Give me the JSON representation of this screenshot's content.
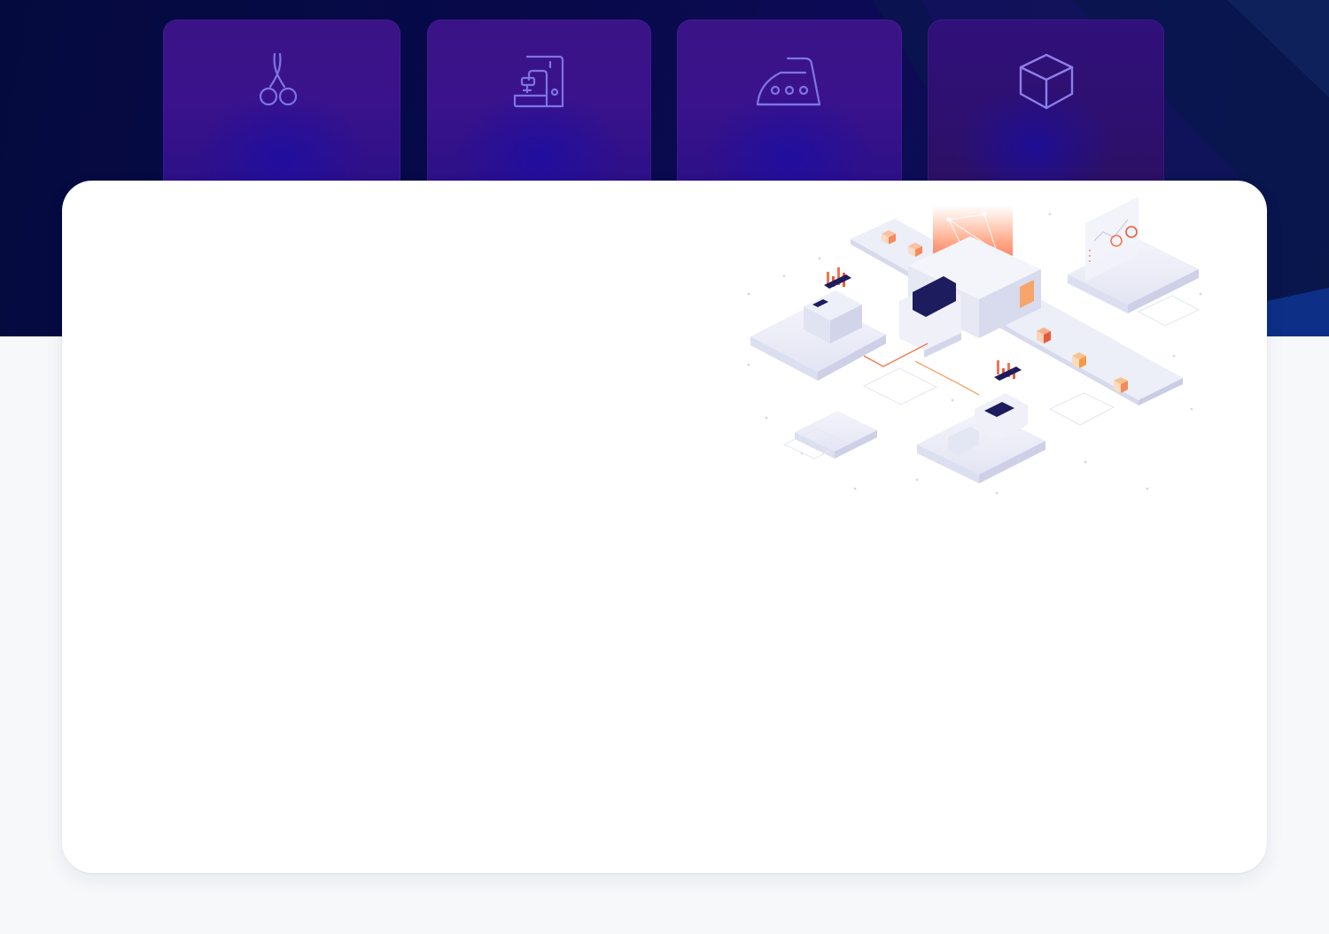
{
  "hero": {
    "feature_cards": [
      {
        "icon": "scissors-icon"
      },
      {
        "icon": "sewing-machine-icon"
      },
      {
        "icon": "clothes-iron-icon"
      },
      {
        "icon": "cube-icon"
      }
    ]
  },
  "panel": {
    "illustration": "isometric-factory-illustration"
  },
  "colors": {
    "hero_background": "#07094a",
    "card_background": "#3a138c",
    "icon_stroke": "#7f74e6",
    "panel_background": "#ffffff",
    "page_background": "#f7f8fa",
    "accent_orange": "#f4744e",
    "accent_navy": "#1c1c5e"
  }
}
